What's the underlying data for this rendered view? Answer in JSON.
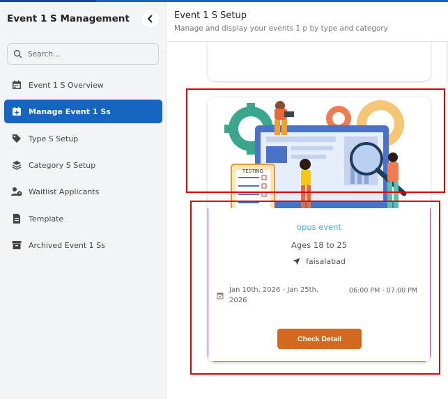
{
  "sidebar": {
    "title": "Event 1 S Management",
    "collapse_icon": "chevron-left-icon",
    "search_placeholder": "Search...",
    "items": [
      {
        "label": "Event 1 S Overview",
        "icon": "calendar-icon",
        "active": false
      },
      {
        "label": "Manage Event 1 Ss",
        "icon": "calendar-plus-icon",
        "active": true
      },
      {
        "label": "Type S Setup",
        "icon": "tags-icon",
        "active": false
      },
      {
        "label": "Category S Setup",
        "icon": "layers-icon",
        "active": false
      },
      {
        "label": "Waitlist Applicants",
        "icon": "user-clock-icon",
        "active": false
      },
      {
        "label": "Template",
        "icon": "file-icon",
        "active": false
      },
      {
        "label": "Archived Event 1 Ss",
        "icon": "archive-icon",
        "active": false
      }
    ]
  },
  "header": {
    "title": "Event 1 S Setup",
    "subtitle": "Manage and display your events 1 p by type and category"
  },
  "event_card": {
    "image_text": "TESTING",
    "name": "opus event",
    "ages": "Ages 18 to 25",
    "location": "faisalabad",
    "date_range": "Jan 10th, 2026 - Jan 25th, 2026",
    "time_range": "06:00 PM - 07:00 PM",
    "button_label": "Check Detail"
  },
  "colors": {
    "primary": "#1565c0",
    "accent_button": "#d2691e",
    "event_name": "#3fb0cc",
    "annotation": "#e00000"
  }
}
